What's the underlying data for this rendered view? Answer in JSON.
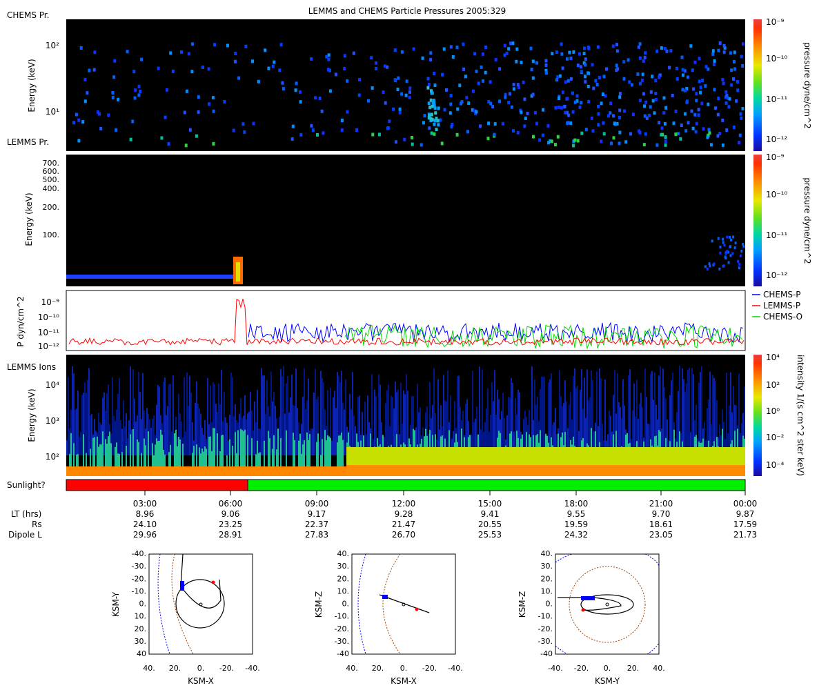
{
  "title": "LEMMS and CHEMS Particle Pressures  2005:329",
  "panels": {
    "chems": {
      "side_label": "CHEMS Pr.",
      "ylabel": "Energy (keV)",
      "yticks": [
        "10²",
        "10¹"
      ],
      "colorbar_label": "pressure dyne/cm^2",
      "colorbar_ticks": [
        "10⁻⁹",
        "10⁻¹⁰",
        "10⁻¹¹",
        "10⁻¹²"
      ]
    },
    "lemms_pr": {
      "side_label": "LEMMS Pr.",
      "ylabel": "Energy (keV)",
      "yticks": [
        "700.",
        "600.",
        "500.",
        "400.",
        "200.",
        "100."
      ],
      "colorbar_label": "pressure dyne/cm^2",
      "colorbar_ticks": [
        "10⁻⁹",
        "10⁻¹⁰",
        "10⁻¹¹",
        "10⁻¹²"
      ]
    },
    "pressure": {
      "ylabel": "P dyn/cm^2",
      "yticks": [
        "10⁻⁹",
        "10⁻¹⁰",
        "10⁻¹¹",
        "10⁻¹²"
      ],
      "legend": [
        "CHEMS-P",
        "LEMMS-P",
        "CHEMS-O"
      ],
      "colors": [
        "#0000ff",
        "#ff0000",
        "#00dd00"
      ]
    },
    "lemms_ions": {
      "side_label": "LEMMS Ions",
      "ylabel": "Energy (keV)",
      "yticks": [
        "10⁴",
        "10³",
        "10²"
      ],
      "colorbar_label": "intensity 1/(s cm^2 ster keV)",
      "colorbar_ticks": [
        "10⁴",
        "10²",
        "10⁰",
        "10⁻²",
        "10⁻⁴"
      ]
    },
    "sunlight": {
      "label": "Sunlight?",
      "colors": [
        "#ff0000",
        "#00ee00"
      ]
    }
  },
  "axis": {
    "row_labels": [
      "LT (hrs)",
      "Rs",
      "Dipole L"
    ],
    "times": [
      "03:00",
      "06:00",
      "09:00",
      "12:00",
      "15:00",
      "18:00",
      "21:00",
      "00:00"
    ],
    "lt": [
      "8.96",
      "9.06",
      "9.17",
      "9.28",
      "9.41",
      "9.55",
      "9.70",
      "9.87"
    ],
    "rs": [
      "24.10",
      "23.25",
      "22.37",
      "21.47",
      "20.55",
      "19.59",
      "18.61",
      "17.59"
    ],
    "dipole_l": [
      "29.96",
      "28.91",
      "27.83",
      "26.70",
      "25.53",
      "24.32",
      "23.05",
      "21.73"
    ]
  },
  "orbits": [
    {
      "xlabel": "KSM-X",
      "ylabel": "KSM-Y",
      "yticks": [
        "-40.",
        "-30.",
        "-20.",
        "-10.",
        "0.",
        "10.",
        "20.",
        "30.",
        "40"
      ],
      "xticks": [
        "40.",
        "20.",
        "0.",
        "-20.",
        "-40."
      ]
    },
    {
      "xlabel": "KSM-X",
      "ylabel": "KSM-Z",
      "yticks": [
        "40.",
        "30.",
        "20.",
        "10.",
        "0.",
        "-10.",
        "-20.",
        "-30.",
        "-40"
      ],
      "xticks": [
        "40.",
        "20.",
        "0.",
        "-20.",
        "-40."
      ]
    },
    {
      "xlabel": "KSM-Y",
      "ylabel": "KSM-Z",
      "yticks": [
        "40.",
        "30.",
        "20.",
        "10.",
        "0.",
        "-10.",
        "-20.",
        "-30.",
        "-40"
      ],
      "xticks": [
        "-40.",
        "-20.",
        "0.",
        "20.",
        "40."
      ]
    }
  ],
  "chart_data": [
    {
      "type": "heatmap",
      "title": "LEMMS and CHEMS Particle Pressures  2005:329",
      "panel": "CHEMS Pr.",
      "ylabel": "Energy (keV)",
      "yscale": "log",
      "colorbar": "pressure dyne/cm^2",
      "crange": [
        "1e-12",
        "1e-9"
      ]
    },
    {
      "type": "heatmap",
      "panel": "LEMMS Pr.",
      "ylabel": "Energy (keV)",
      "colorbar": "pressure dyne/cm^2",
      "crange": [
        "1e-12",
        "1e-9"
      ]
    },
    {
      "type": "line",
      "ylabel": "P dyn/cm^2",
      "yscale": "log",
      "series": [
        {
          "name": "CHEMS-P"
        },
        {
          "name": "LEMMS-P"
        },
        {
          "name": "CHEMS-O"
        }
      ]
    },
    {
      "type": "heatmap",
      "panel": "LEMMS Ions",
      "ylabel": "Energy (keV)",
      "colorbar": "intensity 1/(s cm^2 ster keV)",
      "crange": [
        "1e-4",
        "1e4"
      ]
    }
  ]
}
